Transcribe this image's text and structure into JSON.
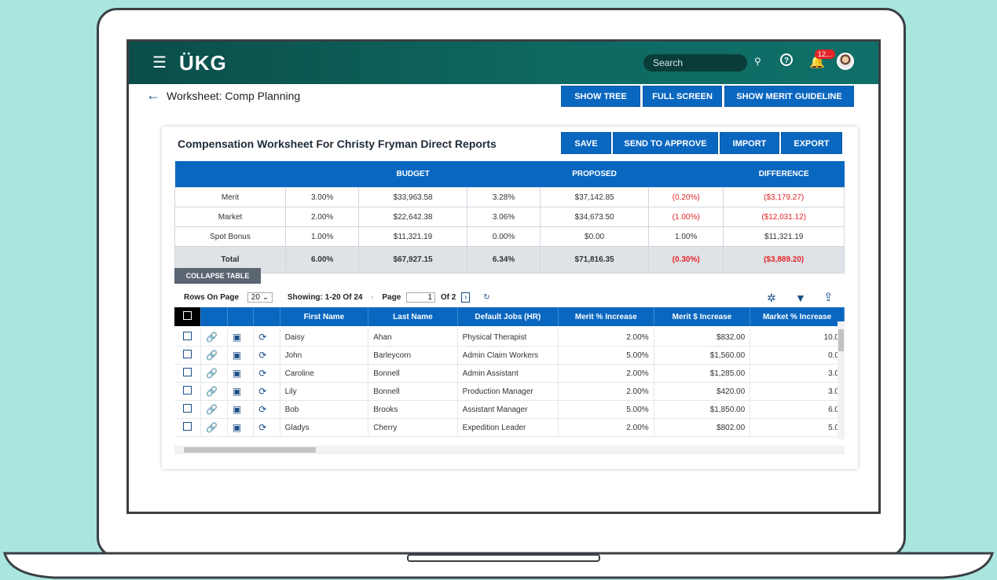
{
  "header": {
    "logo": "ÜKG",
    "search_placeholder": "Search",
    "notification_count": "12..."
  },
  "page": {
    "title": "Worksheet: Comp Planning",
    "buttons": [
      "SHOW TREE",
      "FULL SCREEN",
      "SHOW MERIT GUIDELINE"
    ]
  },
  "card": {
    "title": "Compensation Worksheet For Christy Fryman Direct Reports",
    "buttons": [
      "SAVE",
      "SEND TO APPROVE",
      "IMPORT",
      "EXPORT"
    ]
  },
  "summary": {
    "headers": [
      "BUDGET",
      "PROPOSED",
      "DIFFERENCE"
    ],
    "rows": [
      [
        "Merit",
        "3.00%",
        "$33,963.58",
        "3.28%",
        "$37,142.85",
        "(0.20%)",
        "($3,179.27)"
      ],
      [
        "Market",
        "2.00%",
        "$22,642.38",
        "3.06%",
        "$34,673.50",
        "(1.00%)",
        "($12,031.12)"
      ],
      [
        "Spot Bonus",
        "1.00%",
        "$11,321.19",
        "0.00%",
        "$0.00",
        "1.00%",
        "$11,321.19"
      ],
      [
        "Total",
        "6.00%",
        "$67,927.15",
        "6.34%",
        "$71,816.35",
        "(0.30%)",
        "($3,889.20)"
      ]
    ]
  },
  "table": {
    "collapse_label": "COLLAPSE TABLE",
    "rows_on_page_label": "Rows On Page",
    "rows_on_page_value": "20",
    "showing": "Showing: 1-20 Of 24",
    "page_label": "Page",
    "page_value": "1",
    "page_of": "Of 2",
    "columns": [
      "First Name",
      "Last Name",
      "Default Jobs (HR)",
      "Merit % Increase",
      "Merit $ Increase",
      "Market % Increase"
    ],
    "rows": [
      [
        "Daisy",
        "Ahan",
        "Physical Therapist",
        "2.00%",
        "$832.00",
        "10.0"
      ],
      [
        "John",
        "Barleycorn",
        "Admin Claim Workers",
        "5.00%",
        "$1,560.00",
        "0.0"
      ],
      [
        "Caroline",
        "Bonnell",
        "Admin Assistant",
        "2.00%",
        "$1,285.00",
        "3.0"
      ],
      [
        "Lily",
        "Bonnell",
        "Production Manager",
        "2.00%",
        "$420.00",
        "3.0"
      ],
      [
        "Bob",
        "Brooks",
        "Assistant Manager",
        "5.00%",
        "$1,850.00",
        "6.0"
      ],
      [
        "Gladys",
        "Cherry",
        "Expedition Leader",
        "2.00%",
        "$802.00",
        "5.0"
      ]
    ]
  }
}
